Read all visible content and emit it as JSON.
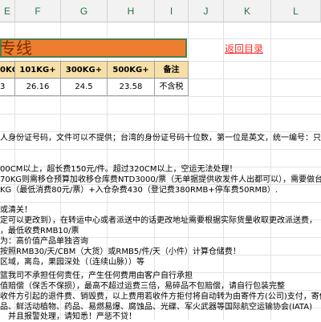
{
  "columns": [
    "E",
    "F",
    "G",
    "H",
    "I",
    "J",
    "K",
    "L"
  ],
  "banner_title": "专线",
  "return_link": "返回目录",
  "table": {
    "headers": [
      "0KG",
      "101KG+",
      "300KG+",
      "500KG+",
      "备注"
    ],
    "values": [
      "3",
      "26.16",
      "24.5",
      "23.58",
      "不含税"
    ]
  },
  "notes": [
    "人身份证号码，文件可以不提供；台湾的身份证号码十位数，第一位是英文，统一编号：只",
    "",
    "00CM以上，超长费150元/件。超过320CM以上，空运无法处理！",
    "70KG则需移仓预算加收移仓库费NTD3000/票（无单据提供收发件人出都可以），需要做台",
    "KG（最低消费80元/票）+入仓杂费430（登记费380RMB+停车费50RMB）.",
    "",
    "或清关！",
    "定可以更改到），在转运中心或者派送中的话更改地址需要根据实际货量收取更改派送费，",
    "，最低收费RMB10/票",
    "为：高价值产品单独咨询",
    "按照RMB30/天/CBM（大货）或RMB5/件/天（小件）计算仓储费！",
    "区域，离岛，果园深处（（连续山脉））等",
    "",
    "篮我司不承担任何责任，产生任何费用由客户自行承担",
    "值赔偿（保舌不保损），最高不超过运费三倍，易碎品不包赔偿，请自行包装完整",
    "收件方引起的退件费、销毁费，以上费用若收件方拒付将自动转为由寄件方(公司)支付，寄件",
    "品、鲜活动植物、药品、易燃易爆、腐蚀品、光碟、军火武器等国际航空运输协会(IATA)",
    "　并且报警处理，请知悉！严惩不贷！"
  ]
}
